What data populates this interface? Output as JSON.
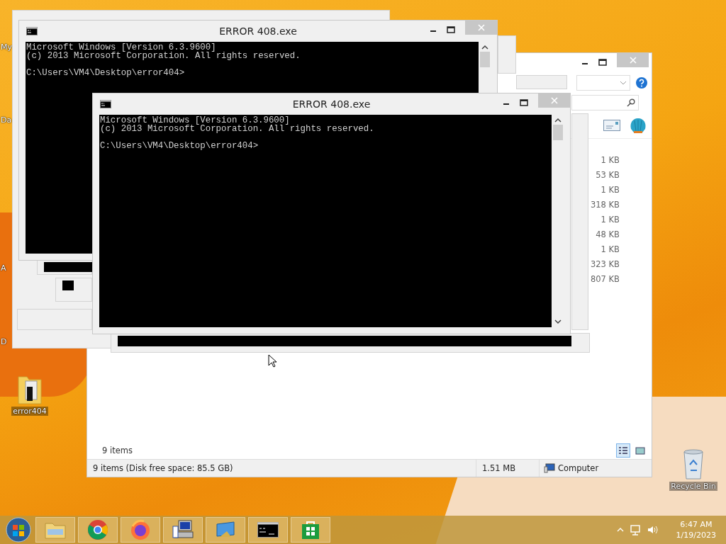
{
  "desktop": {
    "cut_labels": [
      "My",
      "Da",
      "A",
      "D"
    ],
    "icons": [
      {
        "kind": "folder",
        "label": "error404"
      },
      {
        "kind": "recycle-bin",
        "label": "Recycle Bin"
      }
    ]
  },
  "explorer": {
    "item_sizes": [
      "1 KB",
      "53 KB",
      "1 KB",
      "318 KB",
      "1 KB",
      "48 KB",
      "1 KB",
      "323 KB",
      "807 KB"
    ],
    "item_count": "9 items",
    "views": [
      {
        "kind": "details",
        "selected": true
      },
      {
        "kind": "large-icons",
        "selected": false
      }
    ],
    "status_bar": {
      "summary": "9 items (Disk free space: 85.5 GB)",
      "size": "1.51 MB",
      "location": "Computer"
    }
  },
  "consoles": [
    {
      "title": "ERROR 408.exe",
      "lines": [
        "Microsoft Windows [Version 6.3.9600]",
        "(c) 2013 Microsoft Corporation. All rights reserved."
      ],
      "prompt": "C:\\Users\\VM4\\Desktop\\error404>"
    },
    {
      "title": "ERROR 408.exe",
      "lines": [
        "Microsoft Windows [Version 6.3.9600]",
        "(c) 2013 Microsoft Corporation. All rights reserved."
      ],
      "prompt": "C:\\Users\\VM4\\Desktop\\error404>"
    }
  ],
  "taskbar": {
    "buttons": [
      {
        "kind": "file-explorer"
      },
      {
        "kind": "chrome"
      },
      {
        "kind": "firefox"
      },
      {
        "kind": "computer-setup"
      },
      {
        "kind": "display"
      },
      {
        "kind": "console"
      },
      {
        "kind": "store"
      }
    ],
    "clock": {
      "time": "6:47 AM",
      "date": "1/19/2023"
    }
  }
}
